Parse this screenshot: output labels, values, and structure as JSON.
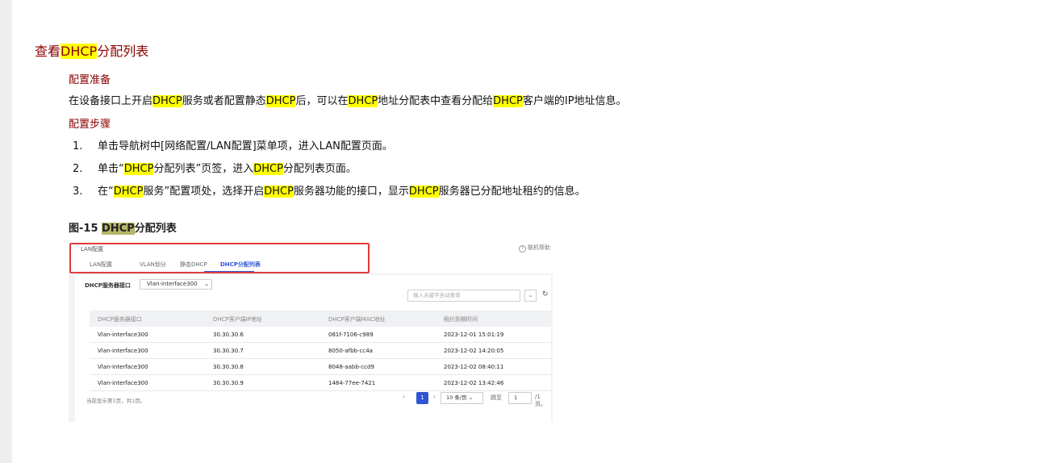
{
  "section_title": {
    "prefix": "查看",
    "hl": "DHCP",
    "suffix": "分配列表"
  },
  "prep": {
    "heading": "配置准备",
    "t1": "在设备接口上开启",
    "h1": "DHCP",
    "t2": "服务或者配置静态",
    "h2": "DHCP",
    "t3": "后，可以在",
    "h3": "DHCP",
    "t4": "地址分配表中查看分配给",
    "h4": "DHCP",
    "t5": "客户端的IP地址信息。"
  },
  "steps_heading": "配置步骤",
  "steps": [
    {
      "num": "1.",
      "text": "单击导航树中[网络配置/LAN配置]菜单项，进入LAN配置页面。"
    },
    {
      "num": "2.",
      "a": "单击“",
      "h1": "DHCP",
      "b": "分配列表”页签，进入",
      "h2": "DHCP",
      "c": "分配列表页面。"
    },
    {
      "num": "3.",
      "a": "在“",
      "h1": "DHCP",
      "b": "服务”配置项处，选择开启",
      "h2": "DHCP",
      "c": "服务器功能的接口，显示",
      "h3": "DHCP",
      "d": "服务器已分配地址租约的信息。"
    }
  ],
  "figure": {
    "label": "图-15 ",
    "hl": "DHCP",
    "suffix": "分配列表",
    "title": "LAN配置",
    "help": "联机帮助",
    "tabs": [
      {
        "label": "LAN配置",
        "active": false
      },
      {
        "label": "VLAN划分",
        "active": false
      },
      {
        "label": "静态DHCP",
        "active": false
      },
      {
        "label": "DHCP分配列表",
        "active": true
      }
    ],
    "server_label": "DHCP服务器接口",
    "server_value": "Vlan-interface300",
    "search_placeholder": "输入关键字自动查询",
    "columns": [
      "DHCP服务器接口",
      "DHCP客户端IP地址",
      "DHCP客户端MAC地址",
      "租约到期时间"
    ],
    "rows": [
      [
        "Vlan-interface300",
        "30.30.30.6",
        "081f-7106-c989",
        "2023-12-01 15:01:19"
      ],
      [
        "Vlan-interface300",
        "30.30.30.7",
        "8050-afbb-cc4a",
        "2023-12-02 14:20:05"
      ],
      [
        "Vlan-interface300",
        "30.30.30.8",
        "8048-aabb-ccd9",
        "2023-12-02 08:40:11"
      ],
      [
        "Vlan-interface300",
        "30.30.30.9",
        "1484-77ee-7421",
        "2023-12-02 13:42:46"
      ]
    ],
    "footer_text": "当前显示第1页，共1页。",
    "page_current": "1",
    "page_size": "10 条/页",
    "goto_label": "跳至",
    "goto_value": "1",
    "total_pages": "/1页。"
  }
}
